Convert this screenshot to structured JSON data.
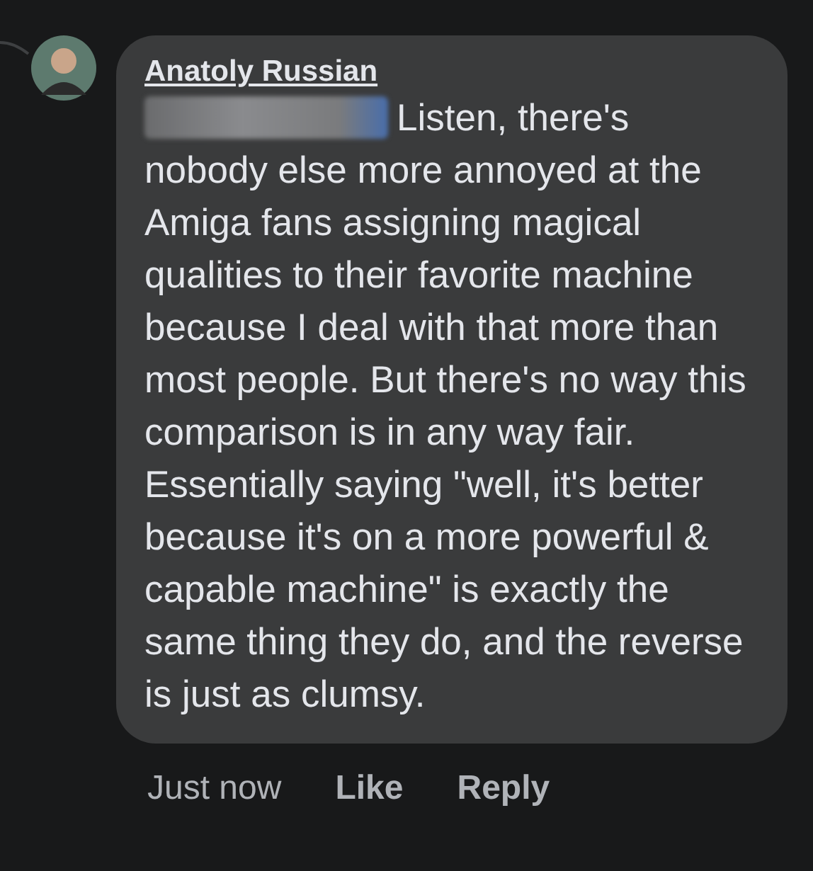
{
  "comment": {
    "author": "Anatoly Russian",
    "mention_redacted": true,
    "text": "Listen, there's nobody else more annoyed at the Amiga fans assigning magical qualities to their favorite machine because I deal with that more than most people. But there's no way this comparison is in any way fair. Essentially saying \"well, it's better because it's on a more powerful & capable machine\" is exactly the same thing they do, and the reverse is just as clumsy."
  },
  "actions": [
    {
      "kind": "time",
      "label": "Just now"
    },
    {
      "kind": "action",
      "label": "Like"
    },
    {
      "kind": "action",
      "label": "Reply"
    }
  ]
}
